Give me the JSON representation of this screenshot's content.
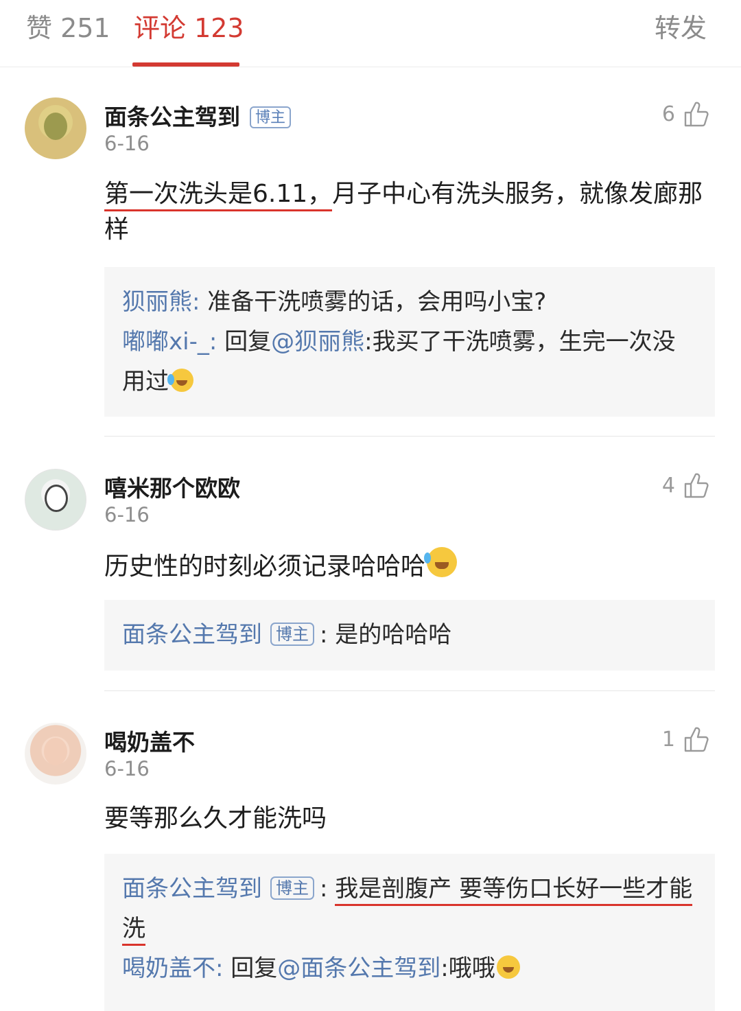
{
  "tabs": {
    "likes": "赞 251",
    "comments": "评论 123",
    "forward": "转发"
  },
  "comments": [
    {
      "name": "面条公主驾到",
      "badge": "博主",
      "date": "6-16",
      "likes": "6",
      "text_underlined": "第一次洗头是6.11，",
      "text_rest": "月子中心有洗头服务，就像发廊那样",
      "replies": [
        {
          "user": "狈丽熊",
          "sep": ": ",
          "text": "准备干洗喷雾的话，会用吗小宝?"
        },
        {
          "user": "嘟嘟xi-_",
          "sep": ": ",
          "prefix": "回复",
          "mention": "@狈丽熊",
          "text": ":我买了干洗喷雾，生完一次没用过",
          "emoji": "crying-laughing-emoji"
        }
      ]
    },
    {
      "name": "嘻米那个欧欧",
      "date": "6-16",
      "likes": "4",
      "text": "历史性的时刻必须记录哈哈哈",
      "emoji": "tears-of-joy-emoji",
      "replies": [
        {
          "user": "面条公主驾到",
          "badge": "博主",
          "sep": ": ",
          "text": "是的哈哈哈"
        }
      ]
    },
    {
      "name": "喝奶盖不",
      "date": "6-16",
      "likes": "1",
      "text": "要等那么久才能洗吗",
      "replies": [
        {
          "user": "面条公主驾到",
          "badge": "博主",
          "sep": ": ",
          "text": "我是剖腹产 要等伤口长好一些才能洗"
        },
        {
          "user": "喝奶盖不",
          "sep": ": ",
          "prefix": "回复",
          "mention": "@面条公主驾到",
          "text": ":哦哦",
          "emoji": "surprised-emoji"
        }
      ]
    }
  ],
  "colors": {
    "accent": "#d33a32",
    "link": "#5478ad",
    "reply_bg": "#f6f6f6"
  }
}
